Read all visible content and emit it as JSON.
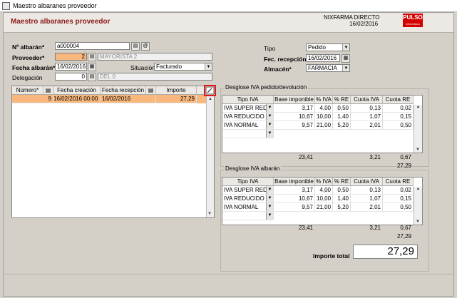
{
  "window": {
    "title": "Maestro albaranes proveedor"
  },
  "header": {
    "title": "Maestro albaranes proveedor",
    "company": "NIXFARMA DIRECTO",
    "date": "16/02/2016",
    "logo": "PULSO",
    "logo_sub": "informática"
  },
  "form": {
    "num_albaran": {
      "label": "Nº albarán*",
      "value": "a000004"
    },
    "proveedor": {
      "label": "Proveedor*",
      "value": "2",
      "name": "MAYORISTA 2"
    },
    "fecha_albaran": {
      "label": "Fecha albarán*",
      "value": "16/02/2016"
    },
    "situacion": {
      "label": "Situación",
      "value": "Facturado"
    },
    "delegacion": {
      "label": "Delegación",
      "value": "0",
      "name": "DEL 0"
    },
    "tipo": {
      "label": "Tipo",
      "value": "Pedido"
    },
    "fec_recepcion": {
      "label": "Fec. recepción*",
      "value": "16/02/2016"
    },
    "almacen": {
      "label": "Almacén*",
      "value": "FARMACIA"
    }
  },
  "lines_table": {
    "columns": [
      "Número*",
      "Fecha creación",
      "Fecha recepción",
      "Importe"
    ],
    "rows": [
      {
        "numero": "9",
        "fecha_creacion": "16/02/2016 00:00",
        "fecha_recepcion": "16/02/2016",
        "importe": "27,29"
      }
    ]
  },
  "iva_pedido": {
    "title": "Desglose IVA pedido/devolución",
    "columns": [
      "Tipo IVA",
      "Base imponible",
      "% IVA",
      "% RE",
      "Cuota IVA",
      "Cuota RE"
    ],
    "rows": [
      {
        "tipo": "IVA SUPER REDU",
        "base": "3,17",
        "iva": "4,00",
        "re": "0,50",
        "cuota_iva": "0,13",
        "cuota_re": "0,02"
      },
      {
        "tipo": "IVA REDUCIDO",
        "base": "10,67",
        "iva": "10,00",
        "re": "1,40",
        "cuota_iva": "1,07",
        "cuota_re": "0,15"
      },
      {
        "tipo": "IVA NORMAL",
        "base": "9,57",
        "iva": "21,00",
        "re": "5,20",
        "cuota_iva": "2,01",
        "cuota_re": "0,50"
      }
    ],
    "total_base": "23,41",
    "total_cuota_iva": "3,21",
    "total_cuota_re": "0,67",
    "total": "27,29"
  },
  "iva_albaran": {
    "title": "Desglose IVA albarán",
    "columns": [
      "Tipo IVA",
      "Base imponible",
      "% IVA",
      "% RE",
      "Cuota IVA",
      "Cuota RE"
    ],
    "rows": [
      {
        "tipo": "IVA SUPER REDU",
        "base": "3,17",
        "iva": "4,00",
        "re": "0,50",
        "cuota_iva": "0,13",
        "cuota_re": "0,02"
      },
      {
        "tipo": "IVA REDUCIDO",
        "base": "10,67",
        "iva": "10,00",
        "re": "1,40",
        "cuota_iva": "1,07",
        "cuota_re": "0,15"
      },
      {
        "tipo": "IVA NORMAL",
        "base": "9,57",
        "iva": "21,00",
        "re": "5,20",
        "cuota_iva": "2,01",
        "cuota_re": "0,50"
      }
    ],
    "total_base": "23,41",
    "total_cuota_iva": "3,21",
    "total_cuota_re": "0,67",
    "total": "27,29"
  },
  "importe_total": {
    "label": "Importe total",
    "value": "27,29"
  },
  "icons": {
    "lookup": "lookup-icon",
    "at": "@",
    "dropdown": "▼",
    "edit": "edit-icon"
  },
  "colors": {
    "accent": "#8b1b1b",
    "highlight": "#f7b77d",
    "logo": "#d40000",
    "callout": "#e01818"
  }
}
